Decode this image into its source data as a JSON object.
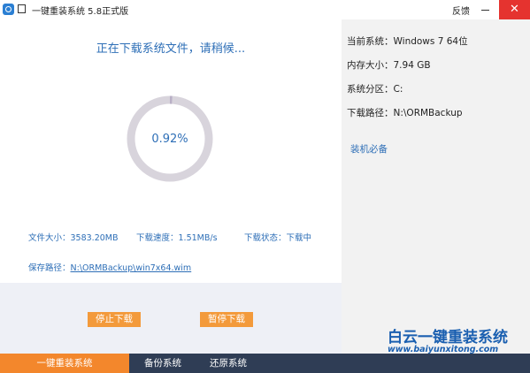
{
  "window": {
    "title": "一键重装系统 5.8正式版",
    "feedback_label": "反馈",
    "close_symbol": "✕"
  },
  "main": {
    "heading": "正在下载系统文件，请稍候...",
    "progress": {
      "value": 0.0092,
      "text": "0.92%"
    },
    "stats": {
      "file_size": "文件大小：3583.20MB",
      "download_speed": "下载速度：1.51MB/s",
      "download_status": "下载状态：下载中"
    },
    "save_path_label": "保存路径：",
    "save_path_value": "N:\\ORMBackup\\win7x64.wim",
    "buttons": {
      "stop": "停止下载",
      "pause": "暂停下载"
    }
  },
  "sidebar": {
    "current_system": "当前系统：Windows 7 64位",
    "memory_size": "内存大小：7.94 GB",
    "system_partition": "系统分区：C:",
    "download_path": "下载路径：N:\\ORMBackup",
    "essentials_link": "装机必备",
    "watermark_title": "白云一键重装系统",
    "watermark_url": "www.baiyunxitong.com"
  },
  "tabs": [
    {
      "label": "一键重装系统",
      "active": true
    },
    {
      "label": "备份系统",
      "active": false
    },
    {
      "label": "还原系统",
      "active": false
    }
  ],
  "colors": {
    "accent_orange": "#f39a3b",
    "tab_active": "#f3872c",
    "bottom_bar": "#2f3d55",
    "text_blue": "#2e6fb7",
    "close_red": "#e5332f",
    "ring_track": "#d8d4dc"
  }
}
